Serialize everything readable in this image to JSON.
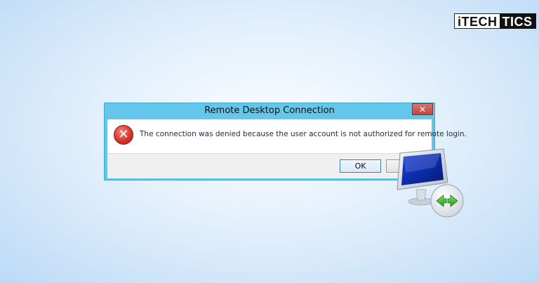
{
  "logo": {
    "part1": "iTECH",
    "part2": "TICS"
  },
  "dialog": {
    "title": "Remote Desktop Connection",
    "close_glyph": "✕",
    "error_glyph": "✕",
    "message": "The connection was denied because the user account is not authorized for remote login.",
    "ok_label": "OK",
    "cancel_label": ""
  },
  "icons": {
    "error": "error-icon",
    "close": "close-icon",
    "remote_desktop": "remote-desktop-icon"
  },
  "colors": {
    "titlebar": "#63c6ea",
    "close_button": "#c7493d",
    "error_red": "#d8342b",
    "background_light": "#fbfdff",
    "background_edge": "#bcdaf6"
  }
}
